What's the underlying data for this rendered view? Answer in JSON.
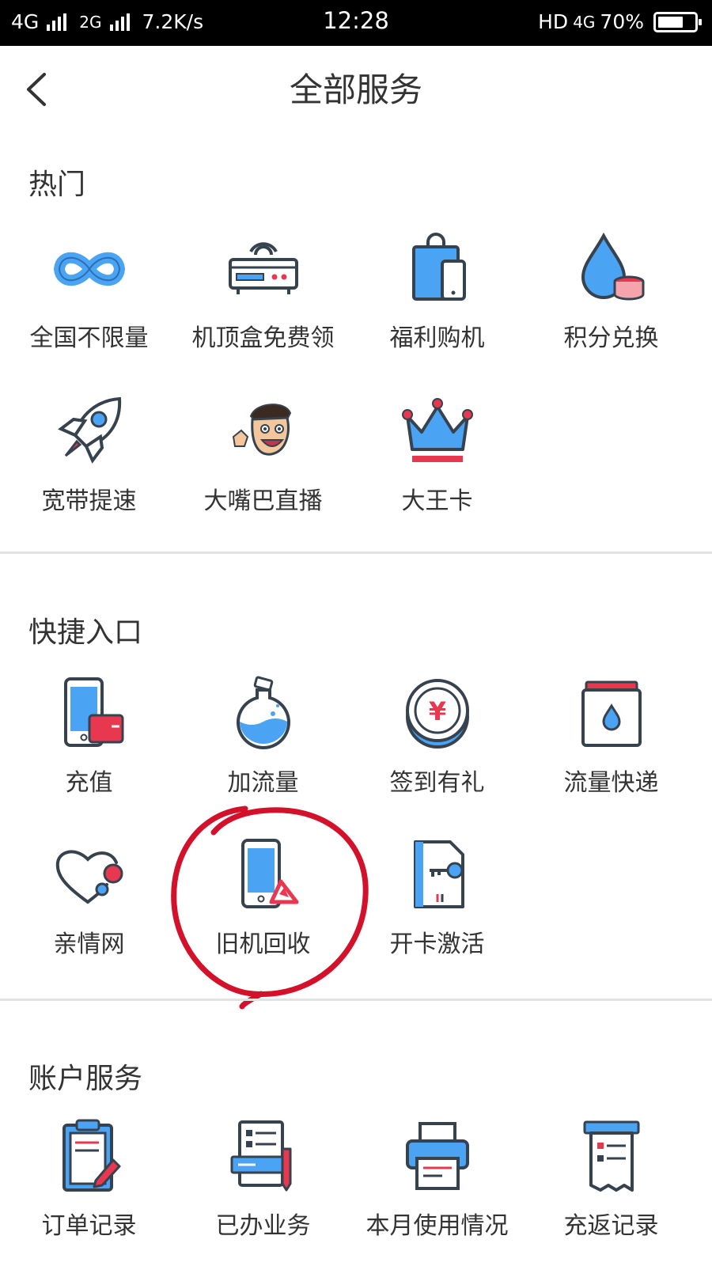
{
  "status_bar": {
    "net1": "4G",
    "net2": "2G",
    "speed": "7.2K/s",
    "time": "12:28",
    "hd": "HD",
    "net3": "4G",
    "battery_text": "70%",
    "battery_level": 0.7
  },
  "header": {
    "title": "全部服务"
  },
  "sections": {
    "hot": {
      "title": "热门",
      "items": [
        {
          "label": "全国不限量",
          "icon": "infinity-icon"
        },
        {
          "label": "机顶盒免费领",
          "icon": "set-top-box-icon"
        },
        {
          "label": "福利购机",
          "icon": "shopping-bag-phone-icon"
        },
        {
          "label": "积分兑换",
          "icon": "drop-coins-icon"
        },
        {
          "label": "宽带提速",
          "icon": "rocket-icon"
        },
        {
          "label": "大嘴巴直播",
          "icon": "cartoon-face-icon"
        },
        {
          "label": "大王卡",
          "icon": "crown-icon"
        }
      ]
    },
    "quick": {
      "title": "快捷入口",
      "items": [
        {
          "label": "充值",
          "icon": "phone-wallet-icon"
        },
        {
          "label": "加流量",
          "icon": "potion-flask-icon"
        },
        {
          "label": "签到有礼",
          "icon": "yen-coin-icon"
        },
        {
          "label": "流量快递",
          "icon": "box-drop-icon"
        },
        {
          "label": "亲情网",
          "icon": "heart-network-icon"
        },
        {
          "label": "旧机回收",
          "icon": "phone-recycle-icon"
        },
        {
          "label": "开卡激活",
          "icon": "sim-key-icon"
        }
      ]
    },
    "account": {
      "title": "账户服务",
      "items": [
        {
          "label": "订单记录",
          "icon": "clipboard-pen-icon"
        },
        {
          "label": "已办业务",
          "icon": "document-card-icon"
        },
        {
          "label": "本月使用情况",
          "icon": "printer-icon"
        },
        {
          "label": "充返记录",
          "icon": "receipt-machine-icon"
        }
      ]
    }
  },
  "colors": {
    "blue": "#4ba3f3",
    "red": "#e8384f",
    "outline": "#37424f",
    "annotation": "#d4112b"
  }
}
